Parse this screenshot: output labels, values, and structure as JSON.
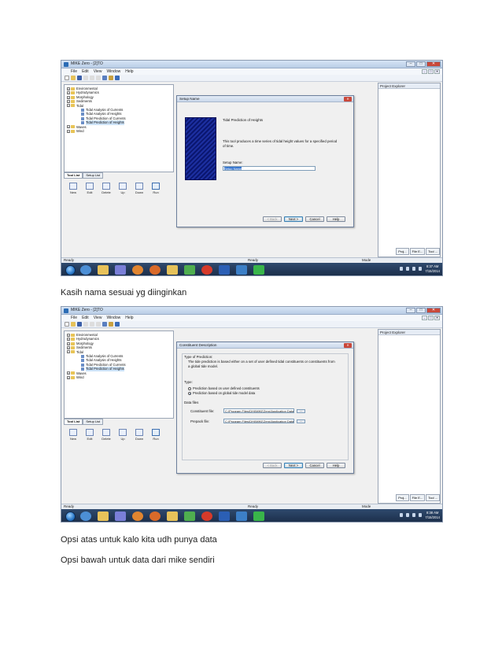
{
  "screenshots": [
    {
      "window_title": "MIKE Zero - [2]TO",
      "menu": [
        "File",
        "Edit",
        "View",
        "Window",
        "Help"
      ],
      "tree": [
        {
          "label": "Environmental",
          "level": 0,
          "kind": "folder"
        },
        {
          "label": "Hydrodynamics",
          "level": 0,
          "kind": "folder"
        },
        {
          "label": "Morphology",
          "level": 0,
          "kind": "folder"
        },
        {
          "label": "Sediments",
          "level": 0,
          "kind": "folder"
        },
        {
          "label": "Tidal",
          "level": 0,
          "kind": "folder",
          "expanded": true
        },
        {
          "label": "Tidal Analysis of Currents",
          "level": 1,
          "kind": "doc"
        },
        {
          "label": "Tidal Analysis of Heights",
          "level": 1,
          "kind": "doc"
        },
        {
          "label": "Tidal Prediction of Currents",
          "level": 1,
          "kind": "doc"
        },
        {
          "label": "Tidal Prediction of Heights",
          "level": 1,
          "kind": "doc",
          "selected": true
        },
        {
          "label": "Waves",
          "level": 0,
          "kind": "folder"
        },
        {
          "label": "Wind",
          "level": 0,
          "kind": "folder"
        }
      ],
      "panel_tabs": [
        "Tool List",
        "Setup List"
      ],
      "tool_buttons": [
        "New",
        "Edit",
        "Delete",
        "Up",
        "Down",
        "Run"
      ],
      "project_explorer_title": "Project Explorer",
      "project_tabs": [
        "Proj...",
        "File E...",
        "Tool ..."
      ],
      "dialog": {
        "title": "Setup Name",
        "heading": "Tidal Prediction of Heights",
        "description": "This tool produces a time series of tidal height values for a specified period of time.",
        "field_label": "Setup Name:",
        "field_value": "Setup Name",
        "buttons": [
          "< Back",
          "Next >",
          "Cancel",
          "Help"
        ]
      },
      "status": {
        "left": "Ready",
        "middle": "Ready",
        "right": "Mode"
      },
      "clock": {
        "time": "8:37 AM",
        "date": "7/15/2014"
      }
    },
    {
      "window_title": "MIKE Zero - [2]TO",
      "menu": [
        "File",
        "Edit",
        "View",
        "Window",
        "Help"
      ],
      "tree": [
        {
          "label": "Environmental",
          "level": 0,
          "kind": "folder"
        },
        {
          "label": "Hydrodynamics",
          "level": 0,
          "kind": "folder"
        },
        {
          "label": "Morphology",
          "level": 0,
          "kind": "folder"
        },
        {
          "label": "Sediments",
          "level": 0,
          "kind": "folder"
        },
        {
          "label": "Tidal",
          "level": 0,
          "kind": "folder",
          "expanded": true
        },
        {
          "label": "Tidal Analysis of Currents",
          "level": 1,
          "kind": "doc"
        },
        {
          "label": "Tidal Analysis of Heights",
          "level": 1,
          "kind": "doc"
        },
        {
          "label": "Tidal Prediction of Currents",
          "level": 1,
          "kind": "doc"
        },
        {
          "label": "Tidal Prediction of Heights",
          "level": 1,
          "kind": "doc",
          "selected": true
        },
        {
          "label": "Waves",
          "level": 0,
          "kind": "folder"
        },
        {
          "label": "Wind",
          "level": 0,
          "kind": "folder"
        }
      ],
      "panel_tabs": [
        "Tool List",
        "Setup List"
      ],
      "tool_buttons": [
        "New",
        "Edit",
        "Delete",
        "Up",
        "Down",
        "Run"
      ],
      "project_explorer_title": "Project Explorer",
      "project_tabs": [
        "Proj...",
        "File E...",
        "Tool ..."
      ],
      "dialog": {
        "title": "Constituent Description",
        "type_heading": "Type of Prediction:",
        "type_text": "The tide prediction is based either on a set of user defined tidal constituents or constituents from a global tide model.",
        "type_label": "Type:",
        "radio_options": [
          {
            "label": "Prediction based on user defined constituents",
            "checked": false
          },
          {
            "label": "Prediction based on global tide model data",
            "checked": true
          }
        ],
        "data_files_label": "Data files",
        "constituent_label": "Constituent file:",
        "constituent_value": "C:\\Program Files\\DHI\\MIKEZero\\Application Data\\Tic",
        "prepack_label": "Prepack file:",
        "prepack_value": "C:\\Program Files\\DHI\\MIKEZero\\Application Data\\Tic",
        "browse_label": "...",
        "buttons": [
          "< Back",
          "Next >",
          "Cancel",
          "Help"
        ]
      },
      "status": {
        "left": "Ready",
        "middle": "Ready",
        "right": "Mode"
      },
      "clock": {
        "time": "8:38 AM",
        "date": "7/15/2014"
      }
    }
  ],
  "captions": [
    "Kasih nama sesuai yg diinginkan",
    "Opsi atas untuk kalo kita udh punya data",
    "Opsi bawah untuk data dari mike sendiri"
  ],
  "taskbar_icons": [
    "chrome-icon",
    "explorer-icon",
    "media-icon",
    "firefox-icon",
    "firefox-icon-2",
    "folder-icon",
    "app-icon",
    "opera-icon",
    "word-icon",
    "paint-icon",
    "line-icon"
  ],
  "colors": {
    "taskbar": "#1f3352",
    "selection": "#3a78d0",
    "wizard_image": "#142a9a"
  }
}
